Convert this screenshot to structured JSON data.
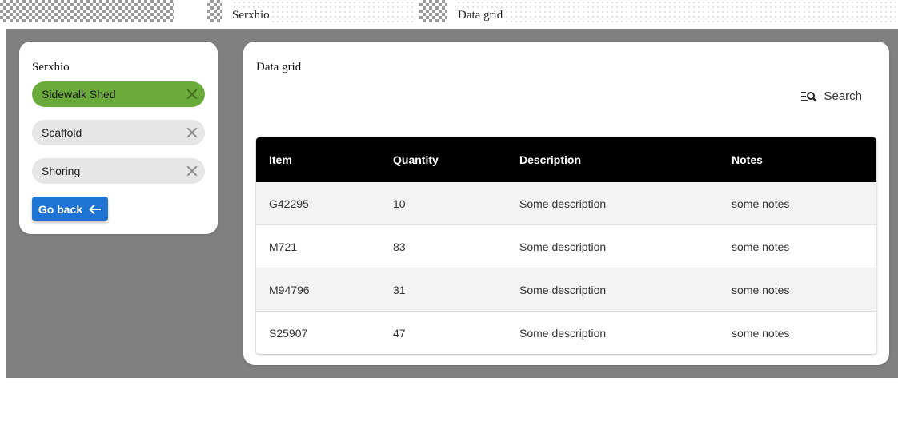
{
  "top_bar": {
    "label_left": "Serxhio",
    "label_right": "Data grid"
  },
  "sidebar": {
    "title": "Serxhio",
    "chips": [
      {
        "label": "Sidewalk Shed",
        "active": true
      },
      {
        "label": "Scaffold",
        "active": false
      },
      {
        "label": "Shoring",
        "active": false
      }
    ],
    "back_button": {
      "label": "Go back",
      "icon": "arrow-left-icon"
    }
  },
  "grid": {
    "title": "Data grid",
    "search": {
      "label": "Search",
      "icon": "search-filter-icon"
    },
    "columns": [
      "Item",
      "Quantity",
      "Description",
      "Notes"
    ],
    "rows": [
      [
        "G42295",
        "10",
        "Some description",
        "some notes"
      ],
      [
        "M721",
        "83",
        "Some description",
        "some notes"
      ],
      [
        "M94796",
        "31",
        "Some description",
        "some notes"
      ],
      [
        "S25907",
        "47",
        "Some description",
        "some notes"
      ]
    ]
  },
  "colors": {
    "active_chip": "#6aaa3a",
    "primary_button": "#1f74d3",
    "header_bg": "#000000",
    "app_bg": "#808080"
  }
}
